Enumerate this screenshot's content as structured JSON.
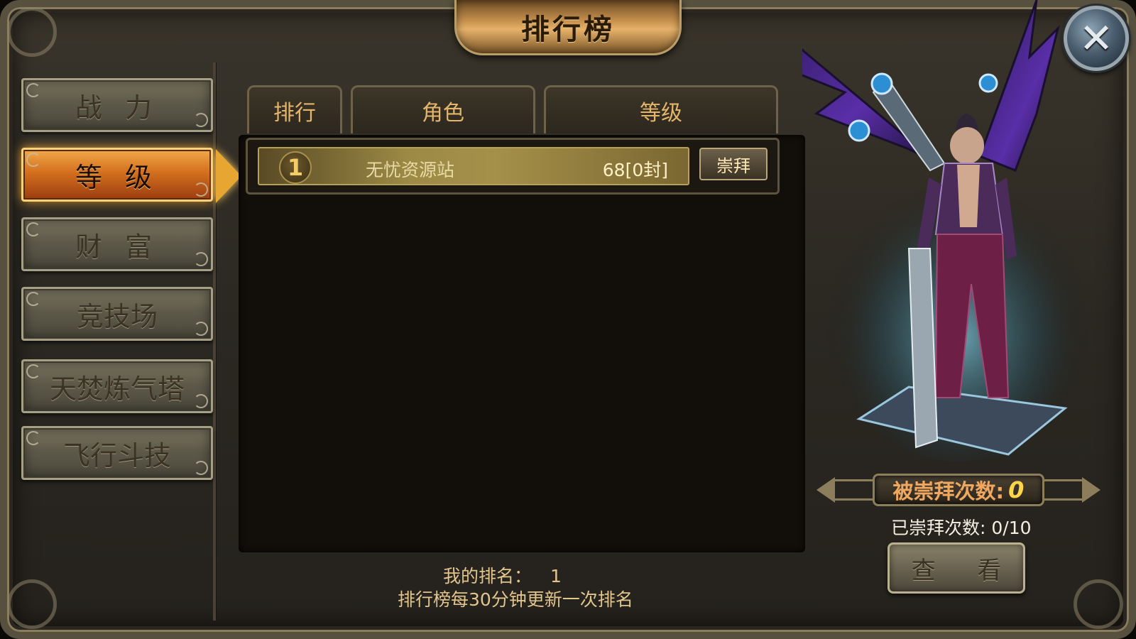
{
  "header": {
    "title": "排行榜",
    "close_icon": "close-icon"
  },
  "sidebar": {
    "items": [
      {
        "label": "战 力",
        "active": false
      },
      {
        "label": "等 级",
        "active": true
      },
      {
        "label": "财 富",
        "active": false
      },
      {
        "label": "竞技场",
        "active": false
      },
      {
        "label": "天焚炼气塔",
        "active": false
      },
      {
        "label": "飞行斗技",
        "active": false
      }
    ]
  },
  "table": {
    "columns": [
      "排行",
      "角色",
      "等级"
    ],
    "rows": [
      {
        "rank": "1",
        "name": "无忧资源站",
        "level": "68[0封]",
        "action_label": "崇拜"
      }
    ]
  },
  "footer": {
    "my_rank_label": "我的排名：",
    "my_rank_value": "1",
    "update_note": "排行榜每30分钟更新一次排名"
  },
  "hero_panel": {
    "worship_received_label": "被崇拜次数:",
    "worship_received_value": "0",
    "worshipped_label": "已崇拜次数: 0/10",
    "view_button_label": "查 看",
    "colors": {
      "accent_gold": "#e7a531",
      "worship_value": "#ffd64a",
      "label_orange": "#f0a860"
    }
  }
}
